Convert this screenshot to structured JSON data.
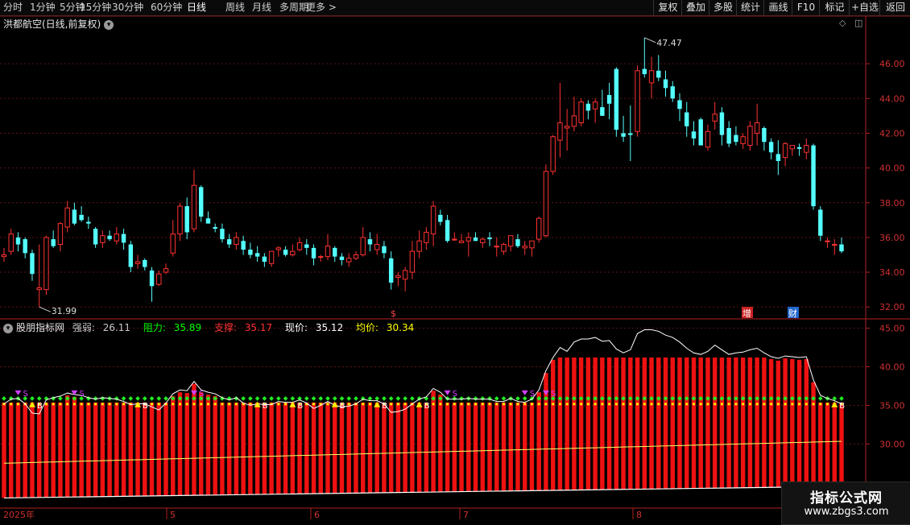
{
  "toolbar": {
    "periods": [
      "分时",
      "1分钟",
      "5分钟",
      "15分钟",
      "30分钟",
      "60分钟",
      "日线",
      "周线",
      "月线",
      "多周期",
      "更多 >"
    ],
    "active_period": "日线",
    "right_buttons": [
      "复权",
      "叠加",
      "多股",
      "统计",
      "画线",
      "F10",
      "标记",
      "+自选",
      "返回"
    ]
  },
  "main_chart": {
    "title": "洪都航空(日线,前复权)",
    "y_ticks": [
      "46.00",
      "44.00",
      "42.00",
      "40.00",
      "38.00",
      "36.00",
      "34.00",
      "32.00"
    ],
    "high_label": "47.47",
    "low_label": "31.99",
    "markers": [
      {
        "text": "$",
        "color": "#ff4a4a"
      },
      {
        "text": "增",
        "color": "#ffffff",
        "bg": "#cc2222"
      },
      {
        "text": "财",
        "color": "#ffffff",
        "bg": "#2266cc"
      }
    ]
  },
  "indicator": {
    "name": "股朋指标网",
    "fields": [
      {
        "label": "强弱: ",
        "value": "26.11",
        "color": "#ffffff"
      },
      {
        "label": "阻力: ",
        "value": "35.89",
        "color": "#00ff00"
      },
      {
        "label": "支撑: ",
        "value": "35.17",
        "color": "#ff3333"
      },
      {
        "label": "现价: ",
        "value": "35.12",
        "color": "#ffffff"
      },
      {
        "label": "均价: ",
        "value": "30.34",
        "color": "#ffff00"
      }
    ],
    "y_ticks": [
      "45.00",
      "40.00",
      "35.00",
      "30.00"
    ],
    "signal_s": "S",
    "signal_b": "B"
  },
  "x_axis": {
    "labels": [
      "2025年",
      "5",
      "6",
      "7",
      "8"
    ]
  },
  "watermark": {
    "title": "指标公式网",
    "url": "www.zbgs3.com"
  },
  "chart_data": {
    "type": "candlestick",
    "y_range": [
      31.5,
      48.0
    ],
    "up_color": "#ff3232",
    "down_color": "#54ffff",
    "ohlc": [
      [
        34.9,
        35.4,
        34.6,
        35.0
      ],
      [
        35.2,
        36.5,
        35.0,
        36.2
      ],
      [
        36.0,
        36.3,
        35.2,
        35.6
      ],
      [
        35.9,
        36.0,
        34.8,
        35.1
      ],
      [
        35.1,
        35.3,
        33.5,
        33.9
      ],
      [
        33.0,
        35.6,
        32.0,
        33.1
      ],
      [
        33.0,
        36.1,
        32.7,
        36.0
      ],
      [
        35.9,
        36.4,
        35.4,
        35.5
      ],
      [
        35.6,
        36.9,
        35.2,
        36.8
      ],
      [
        36.6,
        38.1,
        36.3,
        37.7
      ],
      [
        37.6,
        38.0,
        36.7,
        36.8
      ],
      [
        37.3,
        37.8,
        36.9,
        37.0
      ],
      [
        36.9,
        37.2,
        36.5,
        36.8
      ],
      [
        36.5,
        36.6,
        35.4,
        35.6
      ],
      [
        35.7,
        36.4,
        35.4,
        36.1
      ],
      [
        36.1,
        36.4,
        35.8,
        35.9
      ],
      [
        35.8,
        36.6,
        35.6,
        36.2
      ],
      [
        36.2,
        36.5,
        35.3,
        35.7
      ],
      [
        35.6,
        35.8,
        34.0,
        34.3
      ],
      [
        34.5,
        35.0,
        34.2,
        34.6
      ],
      [
        34.7,
        34.8,
        34.1,
        34.3
      ],
      [
        34.1,
        34.3,
        32.3,
        33.2
      ],
      [
        33.3,
        34.1,
        33.2,
        33.9
      ],
      [
        34.0,
        34.5,
        33.9,
        34.2
      ],
      [
        35.1,
        37.0,
        34.9,
        36.2
      ],
      [
        36.2,
        38.0,
        35.8,
        37.8
      ],
      [
        37.8,
        38.3,
        35.9,
        36.3
      ],
      [
        36.5,
        39.9,
        36.3,
        39.0
      ],
      [
        38.9,
        39.0,
        36.9,
        37.2
      ],
      [
        37.1,
        37.5,
        36.9,
        36.8
      ],
      [
        36.6,
        36.8,
        36.3,
        36.5
      ],
      [
        36.5,
        36.8,
        35.7,
        35.9
      ],
      [
        35.9,
        36.2,
        35.4,
        35.6
      ],
      [
        35.6,
        36.3,
        35.3,
        36.0
      ],
      [
        35.8,
        36.1,
        35.0,
        35.3
      ],
      [
        35.3,
        35.7,
        34.8,
        35.0
      ],
      [
        35.1,
        35.5,
        34.6,
        34.9
      ],
      [
        34.9,
        35.1,
        34.3,
        34.6
      ],
      [
        34.5,
        35.1,
        34.3,
        35.2
      ],
      [
        35.3,
        35.5,
        34.9,
        35.4
      ],
      [
        35.3,
        35.5,
        34.9,
        35.0
      ],
      [
        35.0,
        35.6,
        34.9,
        35.2
      ],
      [
        35.3,
        36.0,
        35.2,
        35.7
      ],
      [
        35.6,
        35.9,
        35.0,
        35.4
      ],
      [
        35.4,
        35.6,
        34.4,
        34.8
      ],
      [
        34.9,
        35.0,
        34.6,
        34.9
      ],
      [
        34.9,
        36.2,
        34.7,
        35.5
      ],
      [
        35.4,
        35.5,
        34.6,
        34.9
      ],
      [
        34.9,
        35.1,
        34.4,
        34.7
      ],
      [
        34.6,
        35.1,
        34.3,
        34.8
      ],
      [
        34.8,
        35.2,
        34.7,
        35.0
      ],
      [
        35.0,
        36.6,
        34.9,
        36.0
      ],
      [
        35.9,
        36.3,
        35.2,
        35.6
      ],
      [
        35.3,
        36.2,
        35.0,
        35.6
      ],
      [
        35.5,
        35.8,
        34.8,
        35.1
      ],
      [
        34.8,
        35.2,
        33.0,
        33.4
      ],
      [
        33.7,
        34.0,
        33.2,
        33.8
      ],
      [
        33.6,
        34.3,
        32.9,
        34.1
      ],
      [
        34.0,
        35.8,
        33.6,
        35.2
      ],
      [
        35.2,
        36.4,
        34.8,
        35.8
      ],
      [
        35.7,
        36.6,
        35.3,
        36.3
      ],
      [
        36.2,
        38.1,
        35.5,
        37.8
      ],
      [
        37.3,
        37.6,
        36.7,
        36.9
      ],
      [
        37.0,
        37.3,
        35.7,
        35.8
      ],
      [
        35.9,
        36.3,
        35.8,
        35.9
      ],
      [
        35.7,
        36.2,
        35.7,
        35.8
      ],
      [
        35.8,
        36.3,
        34.9,
        36.0
      ],
      [
        36.0,
        36.3,
        35.8,
        35.8
      ],
      [
        35.7,
        36.0,
        35.4,
        35.9
      ],
      [
        36.0,
        36.3,
        35.5,
        35.9
      ],
      [
        35.5,
        36.0,
        34.9,
        35.5
      ],
      [
        35.2,
        35.7,
        35.0,
        35.6
      ],
      [
        35.5,
        36.1,
        35.2,
        36.1
      ],
      [
        35.9,
        36.2,
        35.4,
        35.5
      ],
      [
        35.4,
        35.8,
        35.0,
        35.5
      ],
      [
        35.4,
        35.7,
        34.9,
        35.8
      ],
      [
        35.9,
        37.2,
        35.7,
        37.1
      ],
      [
        36.1,
        40.2,
        36.0,
        39.8
      ],
      [
        39.8,
        41.9,
        39.6,
        41.8
      ],
      [
        41.6,
        44.9,
        40.6,
        42.6
      ],
      [
        42.3,
        43.4,
        41.0,
        42.4
      ],
      [
        42.4,
        44.1,
        42.1,
        43.0
      ],
      [
        42.6,
        44.0,
        42.4,
        43.8
      ],
      [
        43.7,
        43.9,
        42.8,
        43.3
      ],
      [
        43.4,
        44.0,
        42.6,
        43.8
      ],
      [
        43.5,
        44.5,
        43.0,
        43.0
      ],
      [
        44.2,
        44.9,
        42.8,
        43.7
      ],
      [
        45.7,
        45.8,
        41.8,
        42.2
      ],
      [
        42.0,
        43.0,
        41.5,
        41.8
      ],
      [
        42.0,
        43.6,
        40.4,
        41.9
      ],
      [
        42.1,
        45.9,
        41.8,
        45.6
      ],
      [
        45.7,
        47.5,
        45.2,
        45.4
      ],
      [
        44.9,
        46.4,
        44.0,
        45.6
      ],
      [
        45.6,
        46.5,
        45.0,
        45.2
      ],
      [
        45.1,
        45.6,
        44.1,
        44.6
      ],
      [
        44.7,
        45.0,
        43.8,
        44.0
      ],
      [
        43.9,
        44.3,
        42.7,
        43.4
      ],
      [
        43.2,
        43.8,
        41.8,
        42.4
      ],
      [
        42.1,
        42.7,
        41.3,
        41.7
      ],
      [
        42.8,
        42.9,
        41.3,
        41.3
      ],
      [
        41.2,
        42.5,
        41.0,
        42.1
      ],
      [
        42.7,
        43.8,
        42.2,
        43.1
      ],
      [
        43.2,
        43.5,
        41.3,
        41.9
      ],
      [
        42.3,
        42.7,
        41.2,
        41.4
      ],
      [
        41.9,
        42.4,
        41.3,
        41.5
      ],
      [
        41.4,
        42.0,
        41.1,
        41.8
      ],
      [
        41.3,
        42.7,
        41.0,
        42.4
      ],
      [
        42.0,
        43.7,
        41.3,
        42.6
      ],
      [
        42.3,
        42.4,
        41.0,
        41.5
      ],
      [
        41.5,
        41.7,
        40.5,
        40.9
      ],
      [
        40.8,
        41.6,
        39.6,
        40.4
      ],
      [
        40.6,
        41.5,
        40.1,
        41.4
      ],
      [
        41.1,
        41.3,
        40.7,
        41.3
      ],
      [
        41.2,
        41.4,
        40.7,
        41.1
      ],
      [
        40.9,
        41.7,
        40.5,
        41.3
      ],
      [
        41.3,
        41.4,
        37.6,
        37.8
      ],
      [
        37.6,
        37.8,
        35.8,
        36.1
      ],
      [
        35.8,
        36.0,
        35.4,
        35.8
      ],
      [
        35.6,
        35.9,
        35.0,
        35.6
      ],
      [
        35.6,
        36.0,
        35.1,
        35.2
      ]
    ],
    "indicator": {
      "y_range": [
        22.0,
        46.0
      ],
      "strength_line": [
        35.2,
        35.8,
        35.9,
        35.2,
        34.0,
        33.9,
        35.7,
        36.0,
        36.2,
        36.6,
        36.4,
        36.3,
        36.0,
        35.8,
        36.0,
        35.9,
        35.8,
        35.5,
        35.1,
        35.2,
        35.2,
        34.8,
        34.4,
        35.3,
        36.5,
        37.0,
        36.9,
        38.1,
        37.0,
        36.7,
        36.5,
        36.0,
        35.7,
        36.0,
        35.3,
        35.0,
        35.2,
        35.1,
        35.1,
        35.5,
        35.4,
        35.4,
        35.7,
        35.3,
        34.6,
        35.0,
        35.5,
        35.0,
        34.8,
        34.9,
        35.2,
        35.8,
        35.6,
        35.6,
        35.2,
        34.1,
        34.2,
        34.5,
        35.2,
        35.8,
        36.1,
        37.2,
        36.7,
        35.8,
        35.8,
        35.8,
        35.9,
        35.8,
        35.8,
        35.8,
        35.5,
        35.5,
        35.9,
        35.5,
        35.4,
        35.8,
        37.0,
        39.5,
        41.2,
        42.5,
        42.0,
        43.2,
        43.6,
        43.6,
        43.8,
        43.3,
        43.4,
        42.3,
        41.8,
        42.2,
        44.3,
        44.8,
        44.8,
        44.6,
        44.1,
        43.8,
        43.2,
        42.4,
        41.8,
        41.6,
        42.0,
        42.8,
        42.2,
        41.6,
        41.8,
        41.9,
        42.2,
        42.4,
        41.8,
        41.3,
        41.1,
        41.4,
        41.3,
        41.2,
        41.3,
        38.3,
        36.3,
        35.9,
        35.6,
        35.2
      ],
      "resistance_value": 35.89,
      "support_value": 35.17,
      "avg_start": 27.5,
      "avg_end": 30.34,
      "bar_bottom_start": 23.0,
      "bar_bottom_end": 24.5
    }
  }
}
